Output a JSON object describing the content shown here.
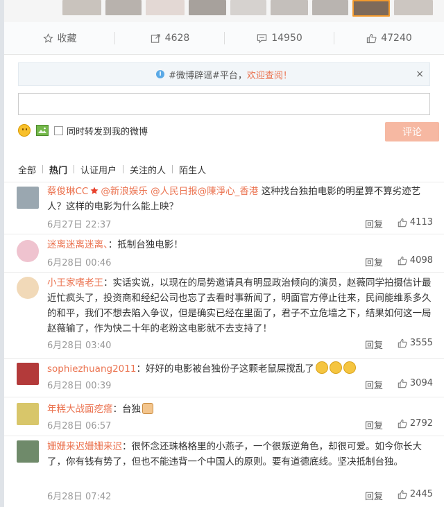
{
  "actions": {
    "favorite": "收藏",
    "repost": "4628",
    "comment": "14950",
    "like": "47240"
  },
  "notice": {
    "prefix": "#微博辟谣#平台，",
    "link": "欢迎查阅！",
    "close": "×"
  },
  "composer": {
    "forward_label": "同时转发到我的微博",
    "submit": "评论"
  },
  "tabs": [
    "全部",
    "热门",
    "认证用户",
    "关注的人",
    "陌生人"
  ],
  "reply_label": "回复",
  "comments": [
    {
      "user": "蔡俊琳CC",
      "mentions": "@新浪娱乐 @人民日报@陳淨心_香港",
      "text": " 这种找台独拍电影的明星算不算劣迹艺人？这样的电影为什么能上映？",
      "time": "6月27日 22:37",
      "likes": "4113"
    },
    {
      "user": "迷离迷离迷离、",
      "text": "：抵制台独电影！",
      "time": "6月28日 00:46",
      "likes": "4098"
    },
    {
      "user": "小王家嗜老王",
      "text": "：实话实说，以现在的局势邀请具有明显政治倾向的演员，赵薇同学拍摄估计最近忙疯头了，投资商和经纪公司也忘了去看时事新闻了，明面官方停止往来，民间能维系多久的和平，我们不想去陷入争议，但是确实已经在里面了，君子不立危墙之下，结果如何这一局赵薇输了，作为快二十年的老粉这电影就不去支持了！",
      "time": "6月28日 03:40",
      "likes": "3555"
    },
    {
      "user": "sophiezhuang2011",
      "text": "：好好的电影被台独份子这颗老鼠屎搅乱了",
      "time": "6月28日 00:39",
      "likes": "3094"
    },
    {
      "user": "年糕大战面疙瘩",
      "text": "：台独",
      "time": "6月28日 06:57",
      "likes": "2792"
    },
    {
      "user": "姗姗来迟姗姗来迟",
      "text": "：很怀念还珠格格里的小燕子，一个很叛逆角色，却很可爱。如今你长大了，你有钱有势了，但也不能违背一个中国人的原则。要有道德底线。坚决抵制台独。",
      "time": "6月28日 07:42",
      "likes": "2445"
    }
  ]
}
